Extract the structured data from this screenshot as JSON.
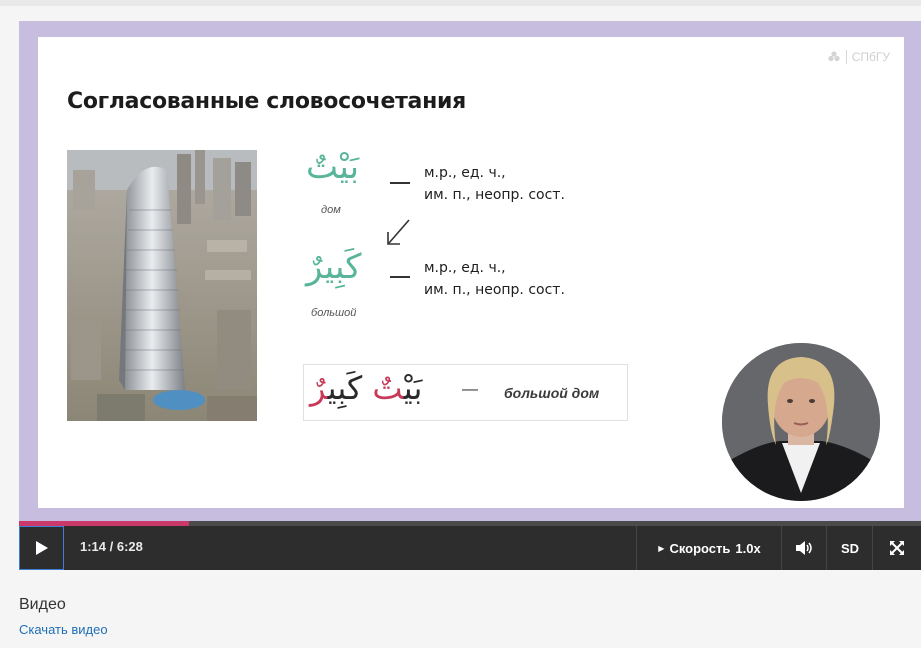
{
  "slide": {
    "title": "Согласованные словосочетания",
    "logo_text": "СПбГУ",
    "word1": {
      "arabic": "بَيْتٌ",
      "translation": "дом",
      "desc_line1": "м.р., ед. ч.,",
      "desc_line2": "им. п., неопр. сост."
    },
    "word2": {
      "arabic": "كَبِيرٌ",
      "translation": "большой",
      "desc_line1": "м.р., ед. ч.,",
      "desc_line2": "им. п., неопр. сост."
    },
    "phrase": {
      "noun_base": "بَيْ",
      "noun_ending": "تٌ",
      "adj_base": "كَبِي",
      "adj_ending": "رٌ",
      "dash": "—",
      "translation": "большой дом"
    }
  },
  "player": {
    "progress": 0.189,
    "time": "1:14 / 6:28",
    "speed_label": "Скорость",
    "speed_value": "1.0x",
    "quality": "SD",
    "icons": {
      "play": "play-icon",
      "volume": "volume-icon",
      "fullscreen": "fullscreen-icon",
      "speed": "triangle-right-icon"
    }
  },
  "below": {
    "label": "Видео",
    "download": "Скачать видео"
  },
  "colors": {
    "accent_green": "#58b59a",
    "accent_red": "#c73956",
    "frame": "#c6bddf",
    "progress": "#c93a6b",
    "link": "#1f6fb5"
  }
}
